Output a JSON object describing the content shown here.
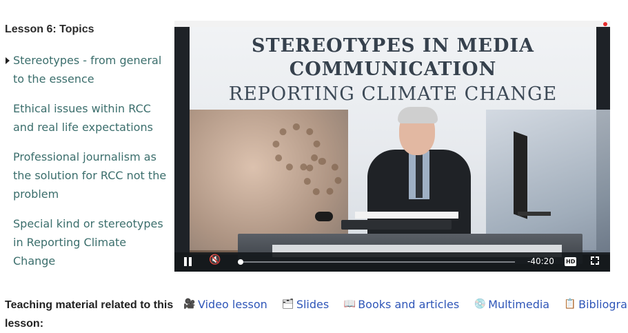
{
  "sidebar": {
    "title": "Lesson 6: Topics",
    "topics": [
      {
        "label": "Stereotypes - from general to the essence"
      },
      {
        "label": "Ethical issues within RCC and real life expectations"
      },
      {
        "label": "Professional journalism as the solution for RCC not the problem"
      },
      {
        "label": "Special kind or stereotypes in Reporting Climate Change"
      }
    ]
  },
  "video": {
    "slide_title_line1": "STEREOTYPES IN MEDIA",
    "slide_title_line2": "COMMUNICATION",
    "slide_title_line3": "REPORTING CLIMATE CHANGE",
    "time_remaining": "-40:20",
    "hd_badge": "HD",
    "progress": 0.0,
    "icons": {
      "pause": "pause-icon",
      "mute": "volume-muted-icon",
      "fullscreen": "fullscreen-icon"
    }
  },
  "materials": {
    "label": "Teaching material related to this lesson:",
    "links": [
      {
        "label": "Video lesson",
        "icon": "video-camera-icon"
      },
      {
        "label": "Slides",
        "icon": "slides-icon"
      },
      {
        "label": "Books and articles",
        "icon": "open-book-icon"
      },
      {
        "label": "Multimedia",
        "icon": "multimedia-disc-icon"
      },
      {
        "label": "Bibliography",
        "icon": "notepad-icon"
      }
    ]
  },
  "colors": {
    "topic_link": "#3b6e6c",
    "material_link": "#2f56b8",
    "player_bar": "#14181c"
  }
}
